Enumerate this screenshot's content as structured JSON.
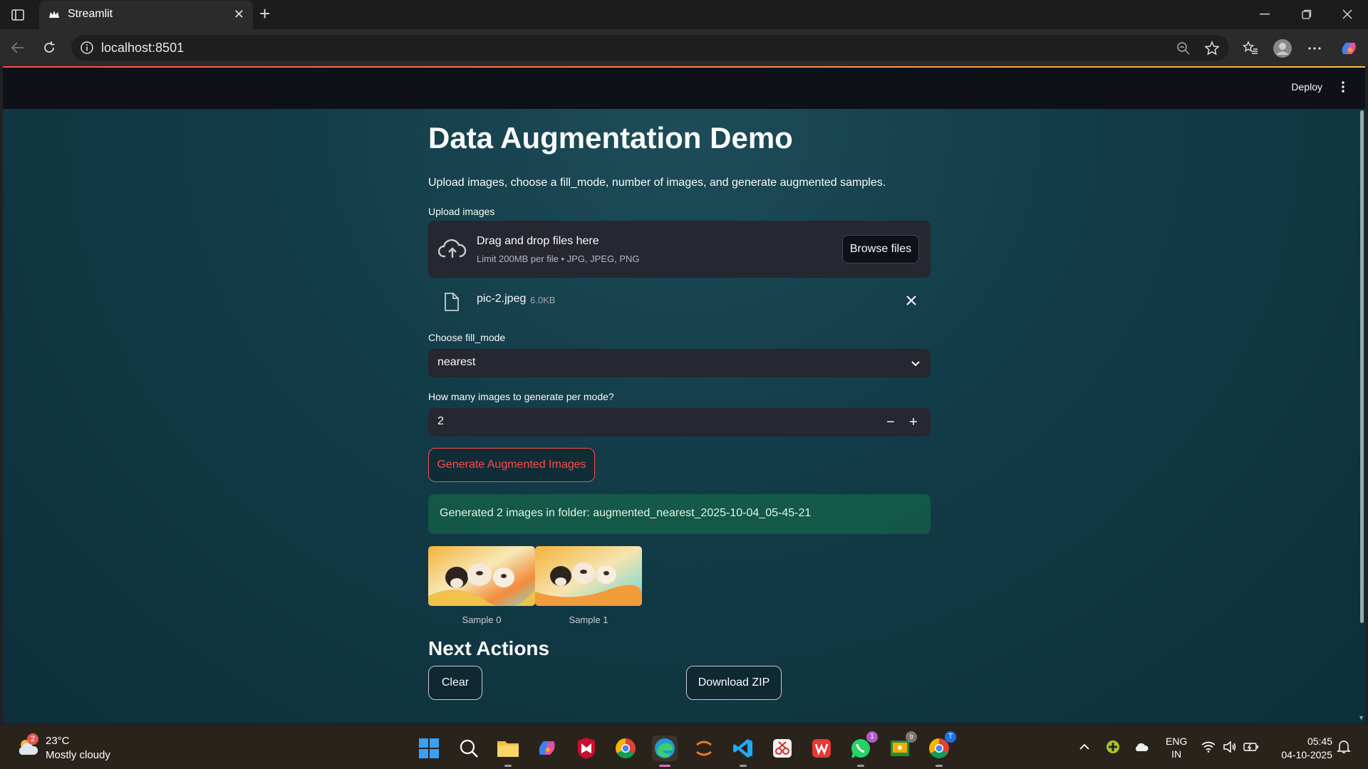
{
  "browser": {
    "tab_title": "Streamlit",
    "url": "localhost:8501"
  },
  "app": {
    "deploy_label": "Deploy",
    "title": "Data Augmentation Demo",
    "subtitle": "Upload images, choose a fill_mode, number of images, and generate augmented samples.",
    "upload": {
      "label": "Upload images",
      "drop_title": "Drag and drop files here",
      "drop_limit": "Limit 200MB per file • JPG, JPEG, PNG",
      "browse_label": "Browse files",
      "file_name": "pic-2.jpeg",
      "file_size": "6.0KB"
    },
    "fill_mode": {
      "label": "Choose fill_mode",
      "value": "nearest"
    },
    "count": {
      "label": "How many images to generate per mode?",
      "value": "2",
      "minus": "−",
      "plus": "+"
    },
    "generate_label": "Generate Augmented Images",
    "success_text": "Generated 2 images in folder: augmented_nearest_2025-10-04_05-45-21",
    "samples": [
      {
        "caption": "Sample 0"
      },
      {
        "caption": "Sample 1"
      }
    ],
    "next_actions": {
      "heading": "Next Actions",
      "clear_label": "Clear",
      "download_label": "Download ZIP"
    }
  },
  "taskbar": {
    "weather_badge": "2",
    "temperature": "23°C",
    "condition": "Mostly cloudy",
    "whatsapp_badge": "1",
    "chrome_badge": "T",
    "lang_line1": "ENG",
    "lang_line2": "IN",
    "time": "05:45",
    "date": "04-10-2025"
  },
  "colors": {
    "accent": "#ff4b4b",
    "success_bg": "#21c354",
    "header_bg": "#0e1117",
    "widget_bg": "#262730"
  }
}
